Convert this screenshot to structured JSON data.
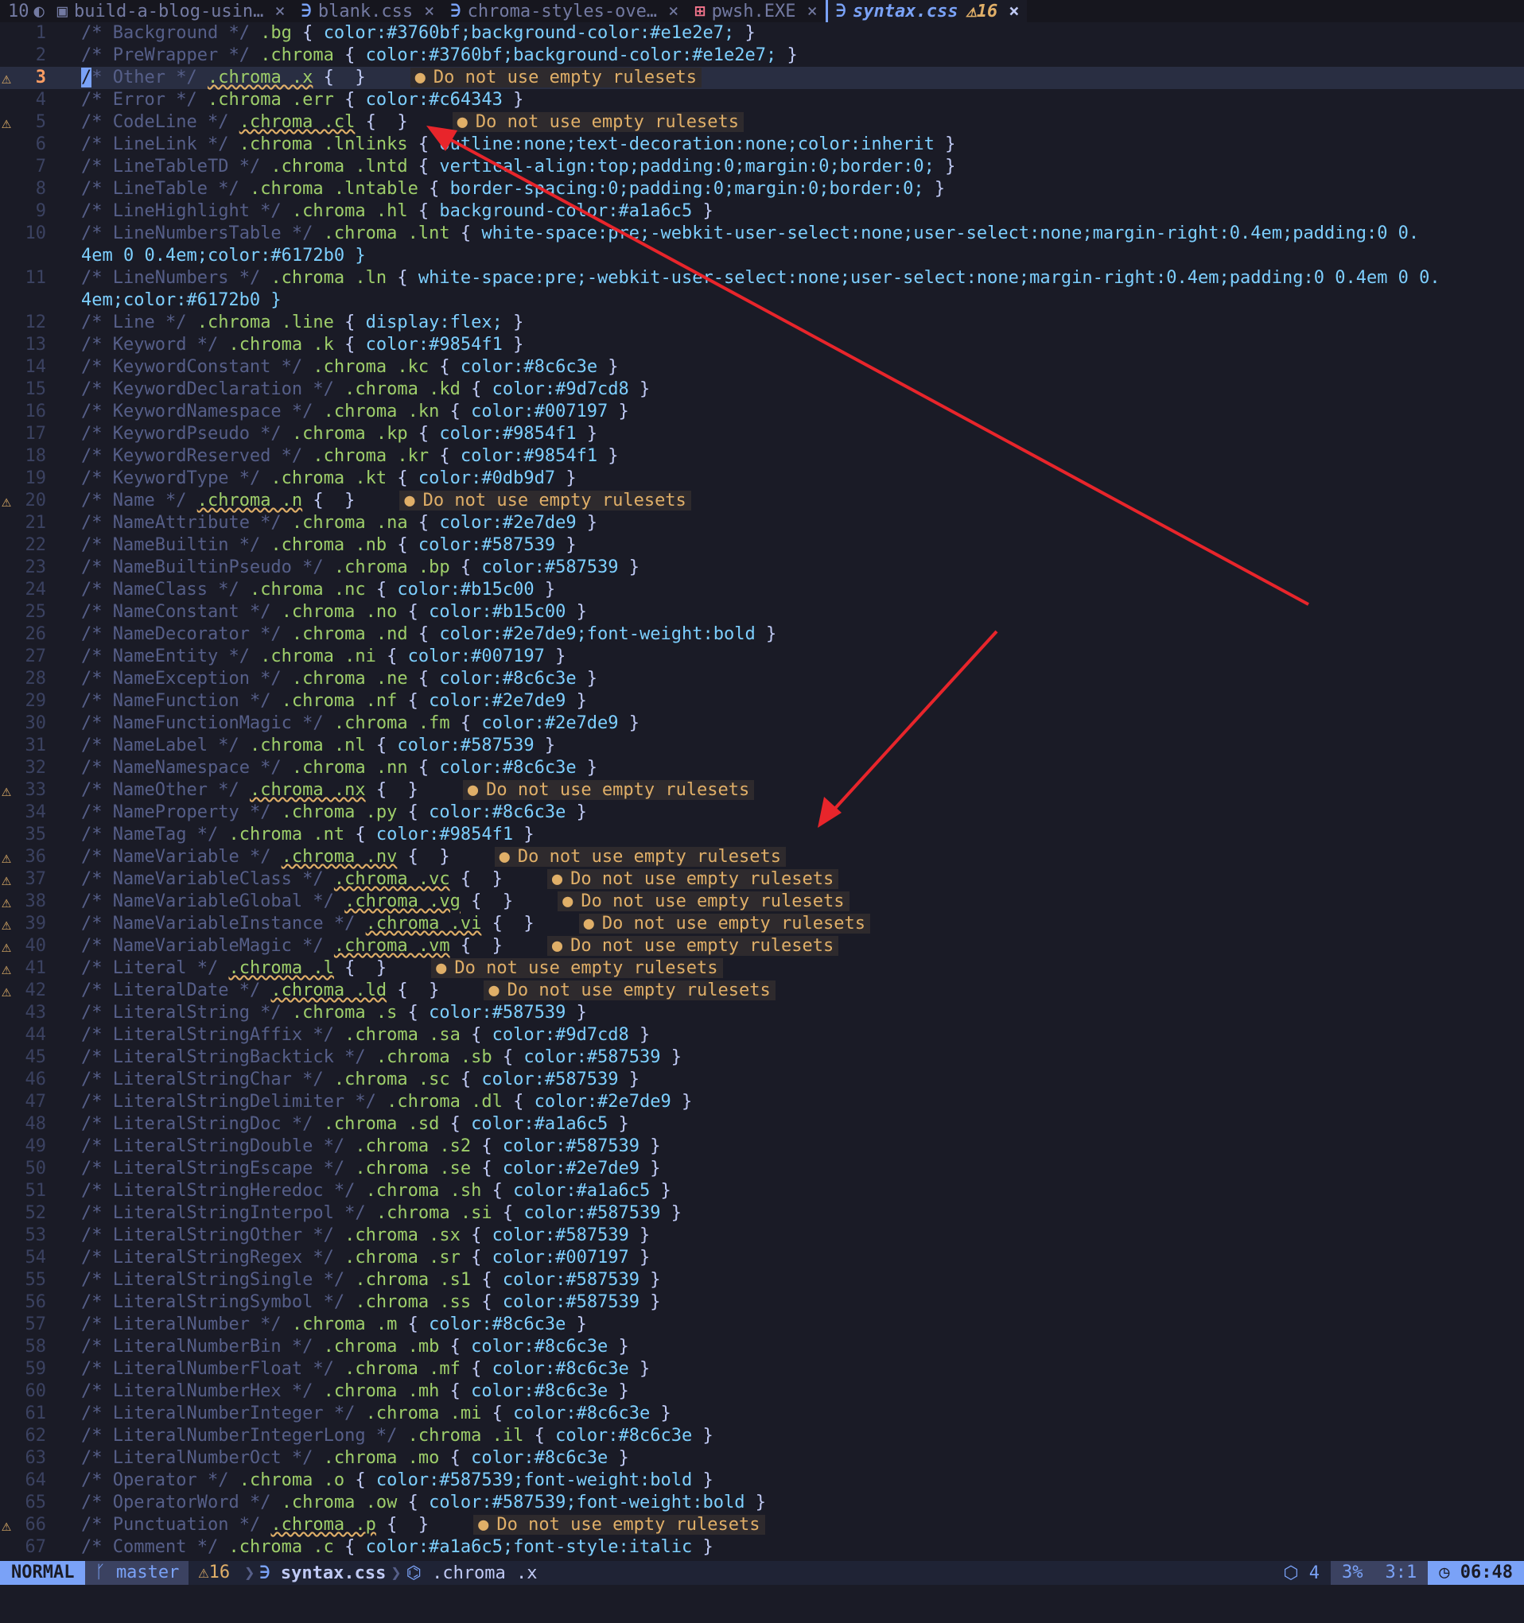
{
  "tabbar": {
    "buffer_count": "10",
    "tabs": [
      {
        "icon": "markdown-icon",
        "name": "build-a-blog-usin…",
        "close": "×",
        "active": false,
        "warn": ""
      },
      {
        "icon": "css-icon",
        "name": "blank.css",
        "close": "×",
        "active": false,
        "warn": ""
      },
      {
        "icon": "css-icon",
        "name": "chroma-styles-ove…",
        "close": "×",
        "active": false,
        "warn": ""
      },
      {
        "icon": "windows-icon",
        "name": "pwsh.EXE",
        "close": "×",
        "active": false,
        "warn": ""
      },
      {
        "icon": "css-icon",
        "name": "syntax.css",
        "close": "×",
        "active": true,
        "warn": "⚠16"
      }
    ]
  },
  "editor": {
    "diagnostic_message": "Do not use empty rulesets",
    "lines": [
      {
        "n": "1",
        "c": "Background",
        "s": ".bg",
        "b": "color:#3760bf;background-color:#e1e2e7;",
        "w": false
      },
      {
        "n": "2",
        "c": "PreWrapper",
        "s": ".chroma",
        "b": "color:#3760bf;background-color:#e1e2e7;",
        "w": false
      },
      {
        "n": "3",
        "c": "Other",
        "s": ".chroma .x",
        "b": "",
        "w": true,
        "cursor": true
      },
      {
        "n": "4",
        "c": "Error",
        "s": ".chroma .err",
        "b": "color:#c64343",
        "w": false
      },
      {
        "n": "5",
        "c": "CodeLine",
        "s": ".chroma .cl",
        "b": "",
        "w": true
      },
      {
        "n": "6",
        "c": "LineLink",
        "s": ".chroma .lnlinks",
        "b": "outline:none;text-decoration:none;color:inherit",
        "w": false
      },
      {
        "n": "7",
        "c": "LineTableTD",
        "s": ".chroma .lntd",
        "b": "vertical-align:top;padding:0;margin:0;border:0;",
        "w": false
      },
      {
        "n": "8",
        "c": "LineTable",
        "s": ".chroma .lntable",
        "b": "border-spacing:0;padding:0;margin:0;border:0;",
        "w": false
      },
      {
        "n": "9",
        "c": "LineHighlight",
        "s": ".chroma .hl",
        "b": "background-color:#a1a6c5",
        "w": false
      },
      {
        "n": "10",
        "c": "LineNumbersTable",
        "s": ".chroma .lnt",
        "b": "white-space:pre;-webkit-user-select:none;user-select:none;margin-right:0.4em;padding:0 0.",
        "wrap": "4em 0 0.4em;color:#6172b0 }",
        "w": false
      },
      {
        "n": "11",
        "c": "LineNumbers",
        "s": ".chroma .ln",
        "b": "white-space:pre;-webkit-user-select:none;user-select:none;margin-right:0.4em;padding:0 0.4em 0 0.",
        "wrap": "4em;color:#6172b0 }",
        "w": false
      },
      {
        "n": "12",
        "c": "Line",
        "s": ".chroma .line",
        "b": "display:flex;",
        "w": false
      },
      {
        "n": "13",
        "c": "Keyword",
        "s": ".chroma .k",
        "b": "color:#9854f1",
        "w": false
      },
      {
        "n": "14",
        "c": "KeywordConstant",
        "s": ".chroma .kc",
        "b": "color:#8c6c3e",
        "w": false
      },
      {
        "n": "15",
        "c": "KeywordDeclaration",
        "s": ".chroma .kd",
        "b": "color:#9d7cd8",
        "w": false
      },
      {
        "n": "16",
        "c": "KeywordNamespace",
        "s": ".chroma .kn",
        "b": "color:#007197",
        "w": false
      },
      {
        "n": "17",
        "c": "KeywordPseudo",
        "s": ".chroma .kp",
        "b": "color:#9854f1",
        "w": false
      },
      {
        "n": "18",
        "c": "KeywordReserved",
        "s": ".chroma .kr",
        "b": "color:#9854f1",
        "w": false
      },
      {
        "n": "19",
        "c": "KeywordType",
        "s": ".chroma .kt",
        "b": "color:#0db9d7",
        "w": false
      },
      {
        "n": "20",
        "c": "Name",
        "s": ".chroma .n",
        "b": "",
        "w": true
      },
      {
        "n": "21",
        "c": "NameAttribute",
        "s": ".chroma .na",
        "b": "color:#2e7de9",
        "w": false
      },
      {
        "n": "22",
        "c": "NameBuiltin",
        "s": ".chroma .nb",
        "b": "color:#587539",
        "w": false
      },
      {
        "n": "23",
        "c": "NameBuiltinPseudo",
        "s": ".chroma .bp",
        "b": "color:#587539",
        "w": false
      },
      {
        "n": "24",
        "c": "NameClass",
        "s": ".chroma .nc",
        "b": "color:#b15c00",
        "w": false
      },
      {
        "n": "25",
        "c": "NameConstant",
        "s": ".chroma .no",
        "b": "color:#b15c00",
        "w": false
      },
      {
        "n": "26",
        "c": "NameDecorator",
        "s": ".chroma .nd",
        "b": "color:#2e7de9;font-weight:bold",
        "w": false
      },
      {
        "n": "27",
        "c": "NameEntity",
        "s": ".chroma .ni",
        "b": "color:#007197",
        "w": false
      },
      {
        "n": "28",
        "c": "NameException",
        "s": ".chroma .ne",
        "b": "color:#8c6c3e",
        "w": false
      },
      {
        "n": "29",
        "c": "NameFunction",
        "s": ".chroma .nf",
        "b": "color:#2e7de9",
        "w": false
      },
      {
        "n": "30",
        "c": "NameFunctionMagic",
        "s": ".chroma .fm",
        "b": "color:#2e7de9",
        "w": false
      },
      {
        "n": "31",
        "c": "NameLabel",
        "s": ".chroma .nl",
        "b": "color:#587539",
        "w": false
      },
      {
        "n": "32",
        "c": "NameNamespace",
        "s": ".chroma .nn",
        "b": "color:#8c6c3e",
        "w": false
      },
      {
        "n": "33",
        "c": "NameOther",
        "s": ".chroma .nx",
        "b": "",
        "w": true
      },
      {
        "n": "34",
        "c": "NameProperty",
        "s": ".chroma .py",
        "b": "color:#8c6c3e",
        "w": false
      },
      {
        "n": "35",
        "c": "NameTag",
        "s": ".chroma .nt",
        "b": "color:#9854f1",
        "w": false
      },
      {
        "n": "36",
        "c": "NameVariable",
        "s": ".chroma .nv",
        "b": "",
        "w": true
      },
      {
        "n": "37",
        "c": "NameVariableClass",
        "s": ".chroma .vc",
        "b": "",
        "w": true
      },
      {
        "n": "38",
        "c": "NameVariableGlobal",
        "s": ".chroma .vg",
        "b": "",
        "w": true
      },
      {
        "n": "39",
        "c": "NameVariableInstance",
        "s": ".chroma .vi",
        "b": "",
        "w": true
      },
      {
        "n": "40",
        "c": "NameVariableMagic",
        "s": ".chroma .vm",
        "b": "",
        "w": true
      },
      {
        "n": "41",
        "c": "Literal",
        "s": ".chroma .l",
        "b": "",
        "w": true
      },
      {
        "n": "42",
        "c": "LiteralDate",
        "s": ".chroma .ld",
        "b": "",
        "w": true
      },
      {
        "n": "43",
        "c": "LiteralString",
        "s": ".chroma .s",
        "b": "color:#587539",
        "w": false
      },
      {
        "n": "44",
        "c": "LiteralStringAffix",
        "s": ".chroma .sa",
        "b": "color:#9d7cd8",
        "w": false
      },
      {
        "n": "45",
        "c": "LiteralStringBacktick",
        "s": ".chroma .sb",
        "b": "color:#587539",
        "w": false
      },
      {
        "n": "46",
        "c": "LiteralStringChar",
        "s": ".chroma .sc",
        "b": "color:#587539",
        "w": false
      },
      {
        "n": "47",
        "c": "LiteralStringDelimiter",
        "s": ".chroma .dl",
        "b": "color:#2e7de9",
        "w": false
      },
      {
        "n": "48",
        "c": "LiteralStringDoc",
        "s": ".chroma .sd",
        "b": "color:#a1a6c5",
        "w": false
      },
      {
        "n": "49",
        "c": "LiteralStringDouble",
        "s": ".chroma .s2",
        "b": "color:#587539",
        "w": false
      },
      {
        "n": "50",
        "c": "LiteralStringEscape",
        "s": ".chroma .se",
        "b": "color:#2e7de9",
        "w": false
      },
      {
        "n": "51",
        "c": "LiteralStringHeredoc",
        "s": ".chroma .sh",
        "b": "color:#a1a6c5",
        "w": false
      },
      {
        "n": "52",
        "c": "LiteralStringInterpol",
        "s": ".chroma .si",
        "b": "color:#587539",
        "w": false
      },
      {
        "n": "53",
        "c": "LiteralStringOther",
        "s": ".chroma .sx",
        "b": "color:#587539",
        "w": false
      },
      {
        "n": "54",
        "c": "LiteralStringRegex",
        "s": ".chroma .sr",
        "b": "color:#007197",
        "w": false
      },
      {
        "n": "55",
        "c": "LiteralStringSingle",
        "s": ".chroma .s1",
        "b": "color:#587539",
        "w": false
      },
      {
        "n": "56",
        "c": "LiteralStringSymbol",
        "s": ".chroma .ss",
        "b": "color:#587539",
        "w": false
      },
      {
        "n": "57",
        "c": "LiteralNumber",
        "s": ".chroma .m",
        "b": "color:#8c6c3e",
        "w": false
      },
      {
        "n": "58",
        "c": "LiteralNumberBin",
        "s": ".chroma .mb",
        "b": "color:#8c6c3e",
        "w": false
      },
      {
        "n": "59",
        "c": "LiteralNumberFloat",
        "s": ".chroma .mf",
        "b": "color:#8c6c3e",
        "w": false
      },
      {
        "n": "60",
        "c": "LiteralNumberHex",
        "s": ".chroma .mh",
        "b": "color:#8c6c3e",
        "w": false
      },
      {
        "n": "61",
        "c": "LiteralNumberInteger",
        "s": ".chroma .mi",
        "b": "color:#8c6c3e",
        "w": false
      },
      {
        "n": "62",
        "c": "LiteralNumberIntegerLong",
        "s": ".chroma .il",
        "b": "color:#8c6c3e",
        "w": false
      },
      {
        "n": "63",
        "c": "LiteralNumberOct",
        "s": ".chroma .mo",
        "b": "color:#8c6c3e",
        "w": false
      },
      {
        "n": "64",
        "c": "Operator",
        "s": ".chroma .o",
        "b": "color:#587539;font-weight:bold",
        "w": false
      },
      {
        "n": "65",
        "c": "OperatorWord",
        "s": ".chroma .ow",
        "b": "color:#587539;font-weight:bold",
        "w": false
      },
      {
        "n": "66",
        "c": "Punctuation",
        "s": ".chroma .p",
        "b": "",
        "w": true
      },
      {
        "n": "67",
        "c": "Comment",
        "s": ".chroma .c",
        "b": "color:#a1a6c5;font-style:italic",
        "w": false
      }
    ]
  },
  "statusbar": {
    "mode": "NORMAL",
    "branch": "master",
    "warnings": "16",
    "filename": "syntax.css",
    "breadcrumb": ".chroma .x",
    "lsp_count": "4",
    "percent": "3%",
    "position": "3:1",
    "clock": "06:48"
  },
  "colors": {
    "background": "#1a1b26",
    "accent": "#7aa2f7",
    "warning": "#e0af68",
    "annotation_arrow": "#e8252b"
  }
}
